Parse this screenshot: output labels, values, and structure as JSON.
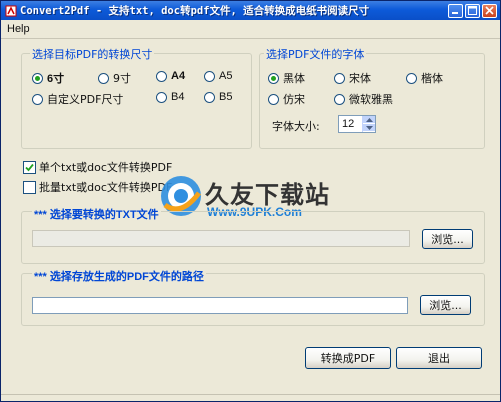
{
  "window": {
    "title": "Convert2Pdf - 支持txt, doc转pdf文件, 适合转换成电纸书阅读尺寸"
  },
  "menu": {
    "help": "Help"
  },
  "size_group": {
    "legend": "选择目标PDF的转换尺寸",
    "options": [
      {
        "label": "6寸",
        "checked": true
      },
      {
        "label": "9寸",
        "checked": false
      },
      {
        "label": "A4",
        "checked": false
      },
      {
        "label": "A5",
        "checked": false
      },
      {
        "label": "自定义PDF尺寸",
        "checked": false
      },
      {
        "label": "B4",
        "checked": false
      },
      {
        "label": "B5",
        "checked": false
      }
    ]
  },
  "font_group": {
    "legend": "选择PDF文件的字体",
    "options": [
      {
        "label": "黑体",
        "checked": true
      },
      {
        "label": "宋体",
        "checked": false
      },
      {
        "label": "楷体",
        "checked": false
      },
      {
        "label": "仿宋",
        "checked": false
      },
      {
        "label": "微软雅黑",
        "checked": false
      }
    ],
    "size_label": "字体大小:",
    "size_value": "12"
  },
  "mode": {
    "single": {
      "label": "单个txt或doc文件转换PDF",
      "checked": true
    },
    "batch": {
      "label": "批量txt或doc文件转换PDF",
      "checked": false
    }
  },
  "txt_section": {
    "title": "*** 选择要转换的TXT文件",
    "path_value": "",
    "browse_label": "浏览..."
  },
  "pdf_section": {
    "title": "*** 选择存放生成的PDF文件的路径",
    "path_value": "",
    "browse_label": "浏览..."
  },
  "actions": {
    "convert_label": "转换成PDF",
    "exit_label": "退出"
  },
  "watermark": {
    "name": "久友下载站",
    "url": "Www.9UPK.Com"
  },
  "colors": {
    "titlebar": "#0d5ad9",
    "legend_text": "#0046d5",
    "section_title": "#0046d5",
    "window_bg": "#ece9d8"
  }
}
